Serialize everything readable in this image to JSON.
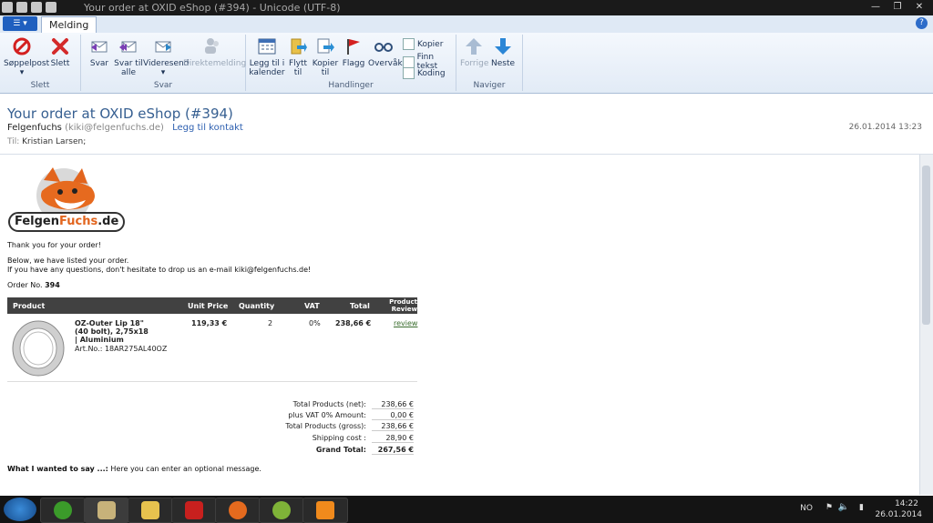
{
  "window": {
    "title": "Your order at OXID eShop (#394) - Unicode (UTF-8)"
  },
  "tabs": {
    "active": "Melding"
  },
  "ribbon": {
    "groups": [
      {
        "label": "Slett",
        "buttons": [
          "Søppelpost",
          "Slett"
        ]
      },
      {
        "label": "Svar",
        "buttons": [
          "Svar",
          "Svar til alle",
          "Videresend",
          "Direktemelding"
        ]
      },
      {
        "label": "Handlinger",
        "buttons": [
          "Legg til i kalender",
          "Flytt til",
          "Kopier til",
          "Flagg",
          "Overvåk"
        ],
        "small": [
          "Kopier",
          "Finn tekst",
          "Koding"
        ]
      },
      {
        "label": "Naviger",
        "buttons": [
          "Forrige",
          "Neste"
        ]
      }
    ]
  },
  "message": {
    "subject": "Your order at OXID eShop (#394)",
    "sender_name": "Felgenfuchs",
    "sender_email": "(kiki@felgenfuchs.de)",
    "add_contact": "Legg til kontakt",
    "date": "26.01.2014 13:23",
    "to_label": "Til:",
    "to_value": "Kristian Larsen;"
  },
  "email": {
    "logo_text_1": "Felgen",
    "logo_text_2": "Fuchs",
    "logo_text_3": ".de",
    "thanks": "Thank you for your order!",
    "below": "Below, we have listed your order.",
    "questions": "If you have any questions, don't hesitate to drop us an e-mail kiki@felgenfuchs.de!",
    "order_label": "Order No.",
    "order_no": "394",
    "columns": [
      "Product",
      "Unit Price",
      "Quantity",
      "VAT",
      "Total",
      "Product Review"
    ],
    "item": {
      "name": "OZ-Outer Lip 18\" (40 bolt), 2,75x18 | Aluminium",
      "artno": "Art.No.: 18AR275AL40OZ",
      "unit_price": "119,33 €",
      "quantity": "2",
      "vat": "0%",
      "total": "238,66 €",
      "review": "review"
    },
    "totals": [
      {
        "label": "Total Products (net):",
        "value": "238,66 €"
      },
      {
        "label": "plus VAT 0% Amount:",
        "value": "0,00 €"
      },
      {
        "label": "Total Products (gross):",
        "value": "238,66 €"
      },
      {
        "label": "Shipping cost :",
        "value": "28,90 €"
      },
      {
        "label": "Grand Total:",
        "value": "267,56 €"
      }
    ],
    "message_label": "What I wanted to say ...:",
    "message_text": "Here you can enter an optional message."
  },
  "taskbar": {
    "lang": "NO",
    "time": "14:22",
    "date": "26.01.2014"
  }
}
